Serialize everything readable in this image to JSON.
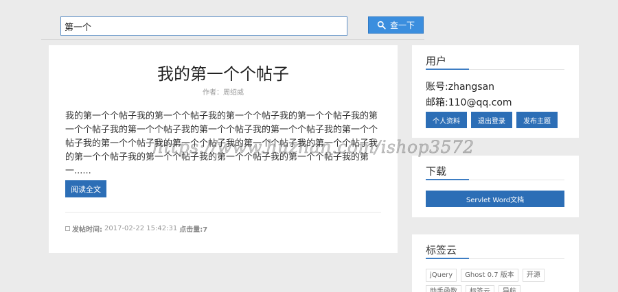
{
  "search": {
    "value": "第一个",
    "button_label": "查一下",
    "button_icon": "search-icon"
  },
  "post": {
    "title": "我的第一个个帖子",
    "author": "作者：周绍威",
    "excerpt": "我的第一个个帖子我的第一个个帖子我的第一个个帖子我的第一个个帖子我的第一个个帖子我的第一个个帖子我的第一个个帖子我的第一个个帖子我的第一个个帖子我的第一个个帖子我的第一个个帖子我的第一个个帖子我的第一个个帖子我的第一个个帖子我的第一个个帖子我的第一个个帖子我的第一个个帖子我的第一......",
    "read_more": "阅读全文",
    "meta_label": "发帖时间:",
    "meta_time": "2017-02-22 15:42:31",
    "meta_views": "点击量:7"
  },
  "user_panel": {
    "title": "用户",
    "account": "账号:zhangsan",
    "email": "邮箱:110@qq.com",
    "buttons": [
      "个人资料",
      "退出登录",
      "发布主题"
    ]
  },
  "download_panel": {
    "title": "下载",
    "button_label": "Servlet Word文档"
  },
  "tag_panel": {
    "title": "标签云",
    "tags": [
      "jQuery",
      "Ghost 0.7 版本",
      "开源",
      "助手函数",
      "标签云",
      "导航"
    ]
  },
  "watermark": "https://www.huzhan.com/ishop3572",
  "colors": {
    "accent": "#2c6eb6",
    "search_button": "#3b8ede",
    "background": "#ebebeb"
  }
}
